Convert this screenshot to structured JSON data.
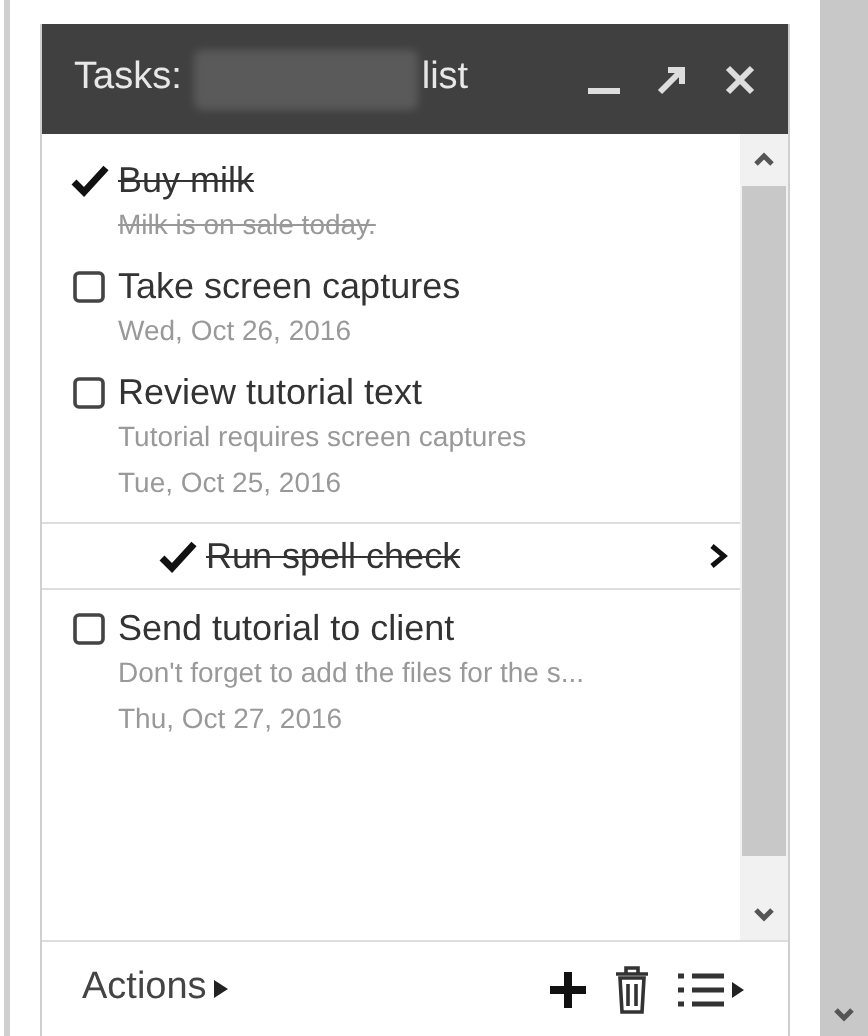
{
  "window": {
    "title_prefix": "Tasks:",
    "title_suffix": "list"
  },
  "tasks": [
    {
      "title": "Buy milk",
      "completed": true,
      "selected": false,
      "note": "Milk is on sale today."
    },
    {
      "title": "Take screen captures",
      "completed": false,
      "selected": false,
      "date": "Wed, Oct 26, 2016"
    },
    {
      "title": "Review tutorial text",
      "completed": false,
      "selected": false,
      "note": "Tutorial requires screen captures",
      "date": "Tue, Oct 25, 2016",
      "children": [
        {
          "title": "Run spell check",
          "completed": true,
          "selected": true
        }
      ]
    },
    {
      "title": "Send tutorial to client",
      "completed": false,
      "selected": false,
      "note": "Don't forget to add the files for the s...",
      "date": "Thu, Oct 27, 2016"
    }
  ],
  "footer": {
    "actions": "Actions"
  }
}
